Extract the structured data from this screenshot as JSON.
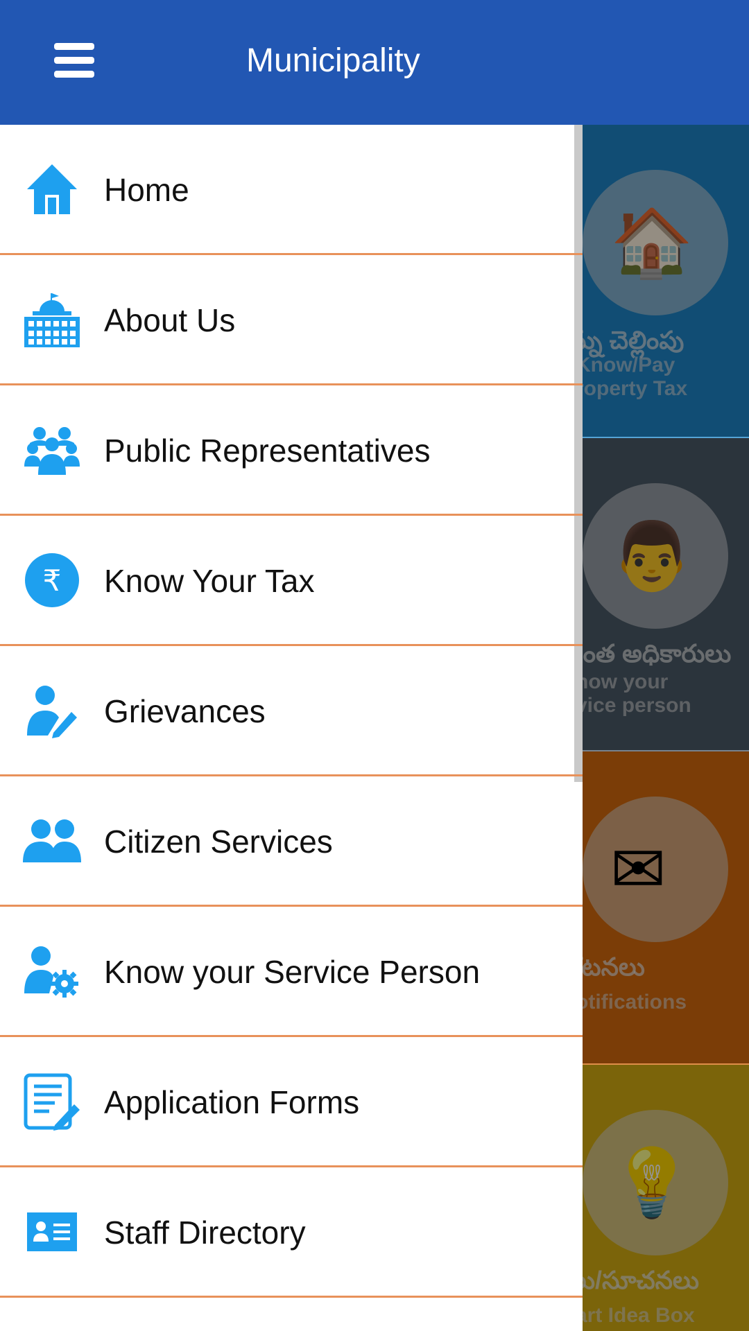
{
  "appbar": {
    "title": "Municipality",
    "menu_icon": "hamburger-icon",
    "background": "#2257b3"
  },
  "drawer": {
    "divider_color": "#e8915a",
    "icon_color": "#1ea0ef",
    "items": [
      {
        "label": "Home",
        "icon": "home-icon"
      },
      {
        "label": "About Us",
        "icon": "building-icon"
      },
      {
        "label": "Public Representatives",
        "icon": "group-icon"
      },
      {
        "label": "Know Your Tax",
        "icon": "rupee-icon"
      },
      {
        "label": "Grievances",
        "icon": "user-edit-icon"
      },
      {
        "label": "Citizen Services",
        "icon": "people-icon"
      },
      {
        "label": "Know your Service Person",
        "icon": "user-gear-icon"
      },
      {
        "label": "Application Forms",
        "icon": "form-edit-icon"
      },
      {
        "label": "Staff Directory",
        "icon": "id-card-icon"
      }
    ]
  },
  "background_tiles": [
    {
      "telugu": "న్ను చెల్లింపు",
      "english": "Know/Pay\nroperty Tax",
      "color": "#1e86c8",
      "icon": "house-icon"
    },
    {
      "telugu": "ంత అధికారులు",
      "english": "now your\nvice person",
      "color": "#4b5a68",
      "icon": "service-person-icon"
    },
    {
      "telugu": "కటనలు",
      "english": "otifications",
      "color": "#d46a0d",
      "icon": "envelope-check-icon"
    },
    {
      "telugu": "లు/సూచనలు",
      "english": "art Idea Box",
      "color": "#d4ac12",
      "icon": "idea-icon"
    }
  ]
}
